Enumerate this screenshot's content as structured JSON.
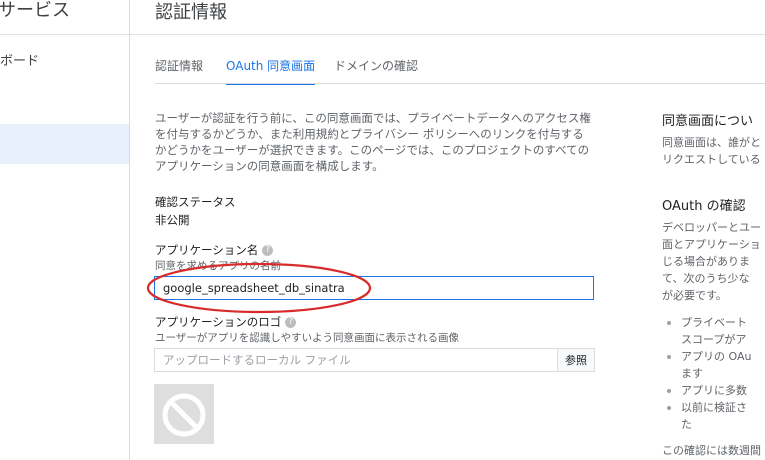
{
  "sidebar": {
    "title": "サービス",
    "items": [
      {
        "label": "ボード"
      },
      {
        "label": ""
      }
    ]
  },
  "page": {
    "title": "認証情報"
  },
  "tabs": [
    {
      "label": "認証情報"
    },
    {
      "label": "OAuth 同意画面"
    },
    {
      "label": "ドメインの確認"
    }
  ],
  "form": {
    "intro": "ユーザーが認証を行う前に、この同意画面では、プライベートデータへのアクセス権を付与するかどうか、また利用規約とプライバシー ポリシーへのリンクを付与するかどうかをユーザーが選択できます。このページでは、このプロジェクトのすべてのアプリケーションの同意画面を構成します。",
    "status_label": "確認ステータス",
    "status_value": "非公開",
    "app_name_label": "アプリケーション名",
    "app_name_sub": "同意を求めるアプリの名前",
    "app_name_value": "google_spreadsheet_db_sinatra",
    "logo_label": "アプリケーションのロゴ",
    "logo_sub": "ユーザーがアプリを認識しやすいよう同意画面に表示される画像",
    "logo_placeholder": "アップロードするローカル ファイル",
    "browse_label": "参照",
    "help_glyph": "?"
  },
  "right": {
    "consent_title": "同意画面につい",
    "consent_text": [
      "同意画面は、誰がと",
      "リクエストしている"
    ],
    "oauth_title": "OAuth の確認",
    "oauth_text": [
      "デベロッパーとユー",
      "面とアプリケーショ",
      "じる場合がありま",
      "て、次のうち少な",
      "が必要です。"
    ],
    "bullets": [
      "プライベート",
      "スコープがア",
      "アプリの OAu",
      "ます",
      "アプリに多数",
      "以前に検証さ",
      "た"
    ],
    "footer": "この確認には数週間"
  },
  "colors": {
    "accent": "#1a73e8",
    "annotation": "#d92b2b"
  }
}
